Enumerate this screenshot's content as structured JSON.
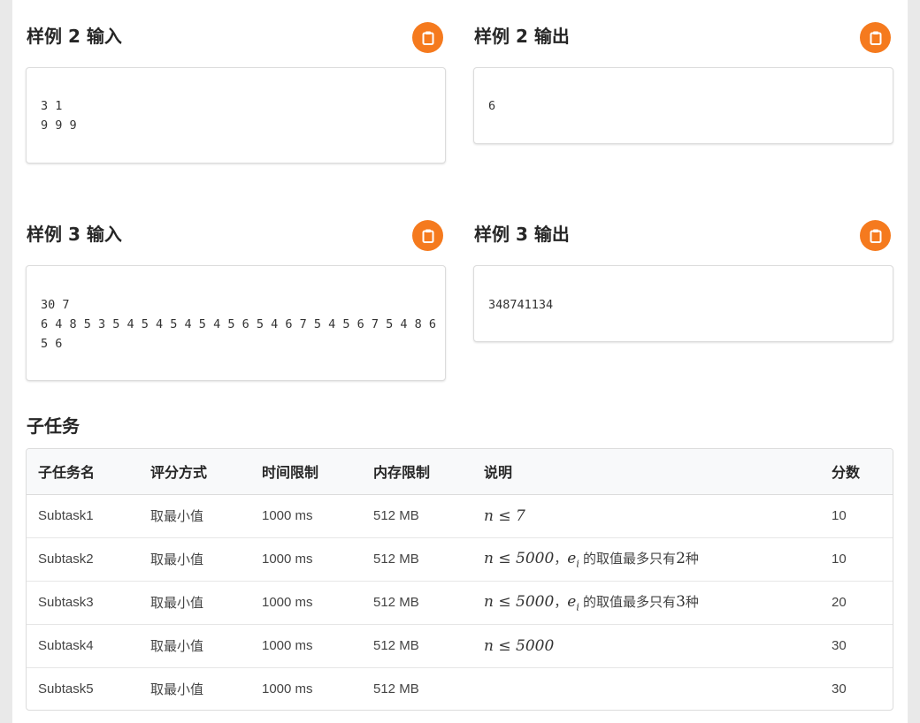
{
  "samples": [
    {
      "input_title": "样例 2 输入",
      "input": "3 1\n9 9 9",
      "output_title": "样例 2 输出",
      "output": "6"
    },
    {
      "input_title": "样例 3 输入",
      "input": "30 7\n6 4 8 5 3 5 4 5 4 5 4 5 4 5 6 5 4 6 7 5 4 5 6 7 5 4 8 6\n5 6",
      "output_title": "样例 3 输出",
      "output": "348741134"
    }
  ],
  "colors": {
    "accent": "#f57a1e"
  },
  "icons": {
    "copy": "clipboard-icon"
  },
  "subtasks": {
    "title": "子任务",
    "headers": [
      "子任务名",
      "评分方式",
      "时间限制",
      "内存限制",
      "说明",
      "分数"
    ],
    "rows": [
      {
        "name": "Subtask1",
        "mode": "取最小值",
        "time": "1000 ms",
        "mem": "512 MB",
        "desc_math": "n ≤ 7",
        "desc_text": "",
        "score": "10"
      },
      {
        "name": "Subtask2",
        "mode": "取最小值",
        "time": "1000 ms",
        "mem": "512 MB",
        "desc_math": "n ≤ 5000",
        "desc_sep": "，",
        "desc_var": "e",
        "desc_sub": "i",
        "desc_text": "的取值最多只有",
        "desc_num": "2",
        "desc_tail": "种",
        "score": "10"
      },
      {
        "name": "Subtask3",
        "mode": "取最小值",
        "time": "1000 ms",
        "mem": "512 MB",
        "desc_math": "n ≤ 5000",
        "desc_sep": "，",
        "desc_var": "e",
        "desc_sub": "i",
        "desc_text": "的取值最多只有",
        "desc_num": "3",
        "desc_tail": "种",
        "score": "20"
      },
      {
        "name": "Subtask4",
        "mode": "取最小值",
        "time": "1000 ms",
        "mem": "512 MB",
        "desc_math": "n ≤ 5000",
        "desc_text": "",
        "score": "30"
      },
      {
        "name": "Subtask5",
        "mode": "取最小值",
        "time": "1000 ms",
        "mem": "512 MB",
        "desc_math": "",
        "desc_text": "",
        "score": "30"
      }
    ]
  }
}
